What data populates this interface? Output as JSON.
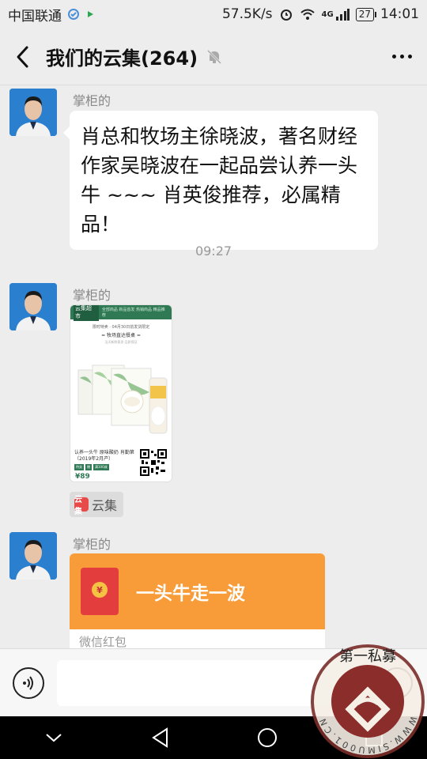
{
  "status_bar": {
    "carrier": "中国联通",
    "speed": "57.5K/s",
    "network": "4G",
    "battery": "27",
    "time": "14:01"
  },
  "header": {
    "title": "我们的云集(264)",
    "back_icon": "chevron-left-icon",
    "mute_icon": "bell-off-icon",
    "more_icon": "more-dots-icon"
  },
  "messages": [
    {
      "type": "text",
      "sender": "掌柜的",
      "text": "肖总和牧场主徐晓波，著名财经作家吴晓波在一起品尝认养一头牛 ~~~ 肖英俊推荐，必属精品！"
    },
    {
      "type": "time",
      "text": "09:27"
    },
    {
      "type": "image",
      "sender": "掌柜的",
      "card": {
        "brand": "云集超市",
        "nav": "全部商品 新品首发 热销商品 精品推荐",
        "line1": "限时特卖 · 04月30日前发货限定",
        "line2": "= 牧场直达餐桌 =",
        "line3": "当天新鲜直发·品质保证",
        "desc": "认养一头牛 原味酸奶 肖勤第（2019年2月产）",
        "tag1": "特卖",
        "tag2": "赠",
        "tag3": "满100减",
        "price": "¥89"
      },
      "source_logo": "云集",
      "source_label": "云集"
    },
    {
      "type": "red_packet",
      "sender": "掌柜的",
      "title": "一头牛走一波",
      "coin": "¥",
      "footer": "微信红包"
    }
  ],
  "input_bar": {
    "voice_icon": "voice-icon",
    "emoji_icon": "emoji-icon"
  },
  "nav_bar": {
    "icons": [
      "collapse-icon",
      "back-triangle-icon",
      "home-circle-icon",
      "recents-square-icon"
    ]
  },
  "watermark": {
    "text": "WWW.SIMU001.CN",
    "chars": "第一私募"
  },
  "colors": {
    "background": "#ededed",
    "red_packet": "#f89c3a",
    "envelope": "#e33d3d",
    "brand_green": "#2f7a55"
  }
}
